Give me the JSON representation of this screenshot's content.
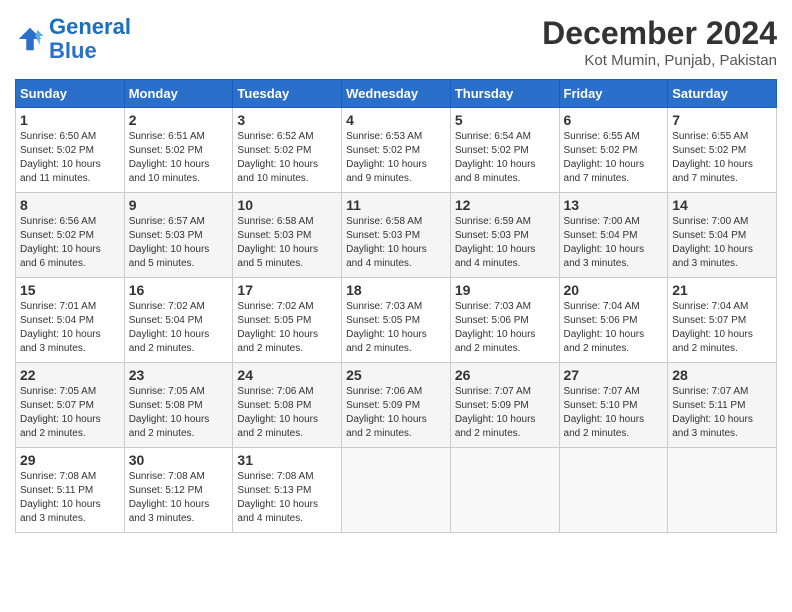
{
  "header": {
    "logo_line1": "General",
    "logo_line2": "Blue",
    "month_title": "December 2024",
    "location": "Kot Mumin, Punjab, Pakistan"
  },
  "weekdays": [
    "Sunday",
    "Monday",
    "Tuesday",
    "Wednesday",
    "Thursday",
    "Friday",
    "Saturday"
  ],
  "weeks": [
    [
      {
        "day": "1",
        "info": "Sunrise: 6:50 AM\nSunset: 5:02 PM\nDaylight: 10 hours and 11 minutes."
      },
      {
        "day": "2",
        "info": "Sunrise: 6:51 AM\nSunset: 5:02 PM\nDaylight: 10 hours and 10 minutes."
      },
      {
        "day": "3",
        "info": "Sunrise: 6:52 AM\nSunset: 5:02 PM\nDaylight: 10 hours and 10 minutes."
      },
      {
        "day": "4",
        "info": "Sunrise: 6:53 AM\nSunset: 5:02 PM\nDaylight: 10 hours and 9 minutes."
      },
      {
        "day": "5",
        "info": "Sunrise: 6:54 AM\nSunset: 5:02 PM\nDaylight: 10 hours and 8 minutes."
      },
      {
        "day": "6",
        "info": "Sunrise: 6:55 AM\nSunset: 5:02 PM\nDaylight: 10 hours and 7 minutes."
      },
      {
        "day": "7",
        "info": "Sunrise: 6:55 AM\nSunset: 5:02 PM\nDaylight: 10 hours and 7 minutes."
      }
    ],
    [
      {
        "day": "8",
        "info": "Sunrise: 6:56 AM\nSunset: 5:02 PM\nDaylight: 10 hours and 6 minutes."
      },
      {
        "day": "9",
        "info": "Sunrise: 6:57 AM\nSunset: 5:03 PM\nDaylight: 10 hours and 5 minutes."
      },
      {
        "day": "10",
        "info": "Sunrise: 6:58 AM\nSunset: 5:03 PM\nDaylight: 10 hours and 5 minutes."
      },
      {
        "day": "11",
        "info": "Sunrise: 6:58 AM\nSunset: 5:03 PM\nDaylight: 10 hours and 4 minutes."
      },
      {
        "day": "12",
        "info": "Sunrise: 6:59 AM\nSunset: 5:03 PM\nDaylight: 10 hours and 4 minutes."
      },
      {
        "day": "13",
        "info": "Sunrise: 7:00 AM\nSunset: 5:04 PM\nDaylight: 10 hours and 3 minutes."
      },
      {
        "day": "14",
        "info": "Sunrise: 7:00 AM\nSunset: 5:04 PM\nDaylight: 10 hours and 3 minutes."
      }
    ],
    [
      {
        "day": "15",
        "info": "Sunrise: 7:01 AM\nSunset: 5:04 PM\nDaylight: 10 hours and 3 minutes."
      },
      {
        "day": "16",
        "info": "Sunrise: 7:02 AM\nSunset: 5:04 PM\nDaylight: 10 hours and 2 minutes."
      },
      {
        "day": "17",
        "info": "Sunrise: 7:02 AM\nSunset: 5:05 PM\nDaylight: 10 hours and 2 minutes."
      },
      {
        "day": "18",
        "info": "Sunrise: 7:03 AM\nSunset: 5:05 PM\nDaylight: 10 hours and 2 minutes."
      },
      {
        "day": "19",
        "info": "Sunrise: 7:03 AM\nSunset: 5:06 PM\nDaylight: 10 hours and 2 minutes."
      },
      {
        "day": "20",
        "info": "Sunrise: 7:04 AM\nSunset: 5:06 PM\nDaylight: 10 hours and 2 minutes."
      },
      {
        "day": "21",
        "info": "Sunrise: 7:04 AM\nSunset: 5:07 PM\nDaylight: 10 hours and 2 minutes."
      }
    ],
    [
      {
        "day": "22",
        "info": "Sunrise: 7:05 AM\nSunset: 5:07 PM\nDaylight: 10 hours and 2 minutes."
      },
      {
        "day": "23",
        "info": "Sunrise: 7:05 AM\nSunset: 5:08 PM\nDaylight: 10 hours and 2 minutes."
      },
      {
        "day": "24",
        "info": "Sunrise: 7:06 AM\nSunset: 5:08 PM\nDaylight: 10 hours and 2 minutes."
      },
      {
        "day": "25",
        "info": "Sunrise: 7:06 AM\nSunset: 5:09 PM\nDaylight: 10 hours and 2 minutes."
      },
      {
        "day": "26",
        "info": "Sunrise: 7:07 AM\nSunset: 5:09 PM\nDaylight: 10 hours and 2 minutes."
      },
      {
        "day": "27",
        "info": "Sunrise: 7:07 AM\nSunset: 5:10 PM\nDaylight: 10 hours and 2 minutes."
      },
      {
        "day": "28",
        "info": "Sunrise: 7:07 AM\nSunset: 5:11 PM\nDaylight: 10 hours and 3 minutes."
      }
    ],
    [
      {
        "day": "29",
        "info": "Sunrise: 7:08 AM\nSunset: 5:11 PM\nDaylight: 10 hours and 3 minutes."
      },
      {
        "day": "30",
        "info": "Sunrise: 7:08 AM\nSunset: 5:12 PM\nDaylight: 10 hours and 3 minutes."
      },
      {
        "day": "31",
        "info": "Sunrise: 7:08 AM\nSunset: 5:13 PM\nDaylight: 10 hours and 4 minutes."
      },
      {
        "day": "",
        "info": ""
      },
      {
        "day": "",
        "info": ""
      },
      {
        "day": "",
        "info": ""
      },
      {
        "day": "",
        "info": ""
      }
    ]
  ]
}
